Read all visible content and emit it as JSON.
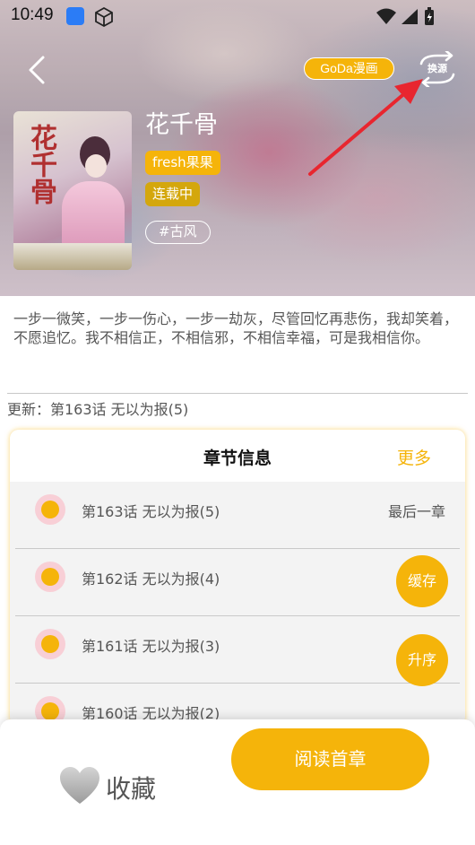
{
  "status_bar": {
    "time": "10:49"
  },
  "header": {
    "source_label": "GoDa漫画",
    "swap_label": "换源",
    "title": "花千骨",
    "cover_title": "花千骨",
    "author": "fresh果果",
    "status": "连载中",
    "genre": "#古风"
  },
  "description": "一步一微笑，一步一伤心，一步一劫灰，尽管回忆再悲伤，我却笑着，不愿追忆。我不相信正，不相信邪，不相信幸福，可是我相信你。",
  "update": "更新：第163话 无以为报(5)",
  "chapters": {
    "header_title": "章节信息",
    "more_label": "更多",
    "items": [
      {
        "name": "第163话 无以为报(5)",
        "note": "最后一章"
      },
      {
        "name": "第162话 无以为报(4)"
      },
      {
        "name": "第161话 无以为报(3)"
      },
      {
        "name": "第160话 无以为报(2)"
      }
    ],
    "cache_label": "缓存",
    "sort_label": "升序"
  },
  "bottom": {
    "favorite_label": "收藏",
    "read_label": "阅读首章"
  },
  "colors": {
    "accent": "#f5b40a",
    "annotation_arrow": "#e8262f"
  }
}
